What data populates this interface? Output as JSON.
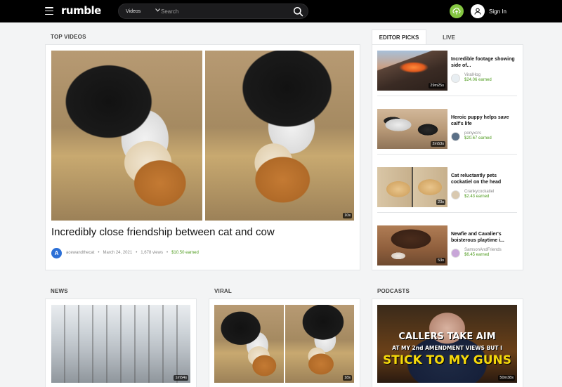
{
  "header": {
    "logo": "rumble",
    "search_category": "Videos",
    "search_placeholder": "Search",
    "signin_label": "Sign In"
  },
  "top_videos": {
    "section_label": "TOP VIDEOS",
    "featured": {
      "title": "Incredibly close friendship between cat and cow",
      "author_initial": "A",
      "author": "acewandthecat",
      "date": "March 24, 2021",
      "views": "1,678 views",
      "earned": "$10.50 earned",
      "duration": "10s"
    }
  },
  "tabs": {
    "editor_picks": "EDITOR PICKS",
    "live": "LIVE"
  },
  "editor_picks": [
    {
      "title": "Incredible footage showing side of...",
      "author": "ViralHog",
      "earned": "$24.06 earned",
      "duration": "29m25s"
    },
    {
      "title": "Heroic puppy helps save calf's life",
      "author": "ponyxcrs",
      "earned": "$20.67 earned",
      "duration": "2m53s"
    },
    {
      "title": "Cat reluctantly pets cockatiel on the head",
      "author": "Crankycockatiel",
      "earned": "$2.43 earned",
      "duration": "23s"
    },
    {
      "title": "Newfie and Cavalier's boisterous playtime i...",
      "author": "SamsonAndFriends",
      "earned": "$6.45 earned",
      "duration": "53s"
    }
  ],
  "news": {
    "section_label": "NEWS",
    "duration": "1m54s"
  },
  "viral": {
    "section_label": "VIRAL",
    "duration": "18s"
  },
  "podcasts": {
    "section_label": "PODCASTS",
    "duration": "50m38s",
    "thumb_line1": "CALLERS TAKE AIM",
    "thumb_line2": "AT MY 2nd AMENDMENT VIEWS BUT I",
    "thumb_line3": "STICK TO MY GUNS"
  },
  "colors": {
    "header_bg": "#000000",
    "accent_green": "#85c742",
    "earned_green": "#4c9a1b",
    "page_bg": "#f3f4f5"
  }
}
